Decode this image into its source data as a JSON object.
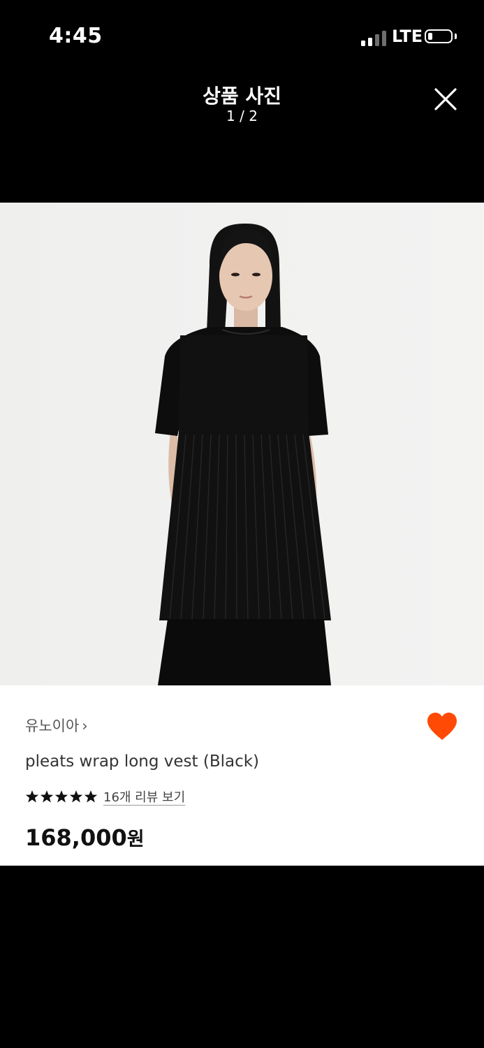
{
  "status_bar": {
    "time": "4:45",
    "network": "LTE",
    "signal_bars_active": 2,
    "signal_bars_total": 4,
    "battery_level": 0.12
  },
  "viewer": {
    "title": "상품 사진",
    "counter": "1 / 2",
    "close_icon": "close-icon"
  },
  "product": {
    "brand": "유노이아",
    "brand_chevron": "›",
    "name": "pleats wrap long vest (Black)",
    "rating": 5,
    "review_link": "16개 리뷰 보기",
    "price": "168,000",
    "price_unit": "원",
    "liked": true
  },
  "colors": {
    "accent": "#ff4a06",
    "background": "#000000",
    "card": "#ffffff"
  }
}
